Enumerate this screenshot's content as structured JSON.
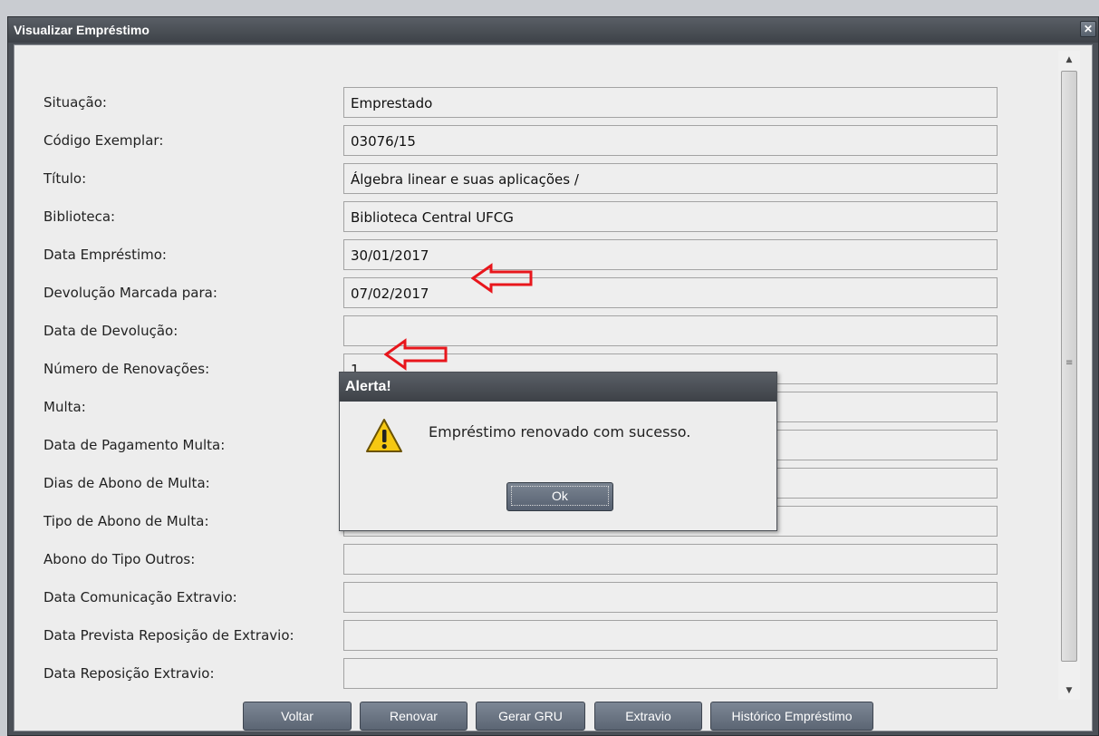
{
  "window": {
    "title": "Visualizar Empréstimo",
    "close_glyph": "✕"
  },
  "form": {
    "rows": [
      {
        "label": "Situação:",
        "value": "Emprestado"
      },
      {
        "label": "Código Exemplar:",
        "value": "03076/15"
      },
      {
        "label": "Título:",
        "value": "Álgebra linear e suas aplicações /"
      },
      {
        "label": "Biblioteca:",
        "value": "Biblioteca Central UFCG"
      },
      {
        "label": "Data Empréstimo:",
        "value": "30/01/2017"
      },
      {
        "label": "Devolução Marcada para:",
        "value": "07/02/2017"
      },
      {
        "label": "Data de Devolução:",
        "value": ""
      },
      {
        "label": "Número de Renovações:",
        "value": "1"
      },
      {
        "label": "Multa:",
        "value": ""
      },
      {
        "label": "Data de Pagamento Multa:",
        "value": ""
      },
      {
        "label": "Dias de Abono de Multa:",
        "value": ""
      },
      {
        "label": "Tipo de Abono de Multa:",
        "value": ""
      },
      {
        "label": "Abono do Tipo Outros:",
        "value": ""
      },
      {
        "label": "Data Comunicação Extravio:",
        "value": ""
      },
      {
        "label": "Data Prevista Reposição de Extravio:",
        "value": ""
      },
      {
        "label": "Data Reposição Extravio:",
        "value": ""
      }
    ]
  },
  "buttons": {
    "voltar": "Voltar",
    "renovar": "Renovar",
    "gerar_gru": "Gerar GRU",
    "extravio": "Extravio",
    "historico": "Histórico Empréstimo"
  },
  "alert": {
    "title": "Alerta!",
    "message": "Empréstimo renovado com sucesso.",
    "ok_label": "Ok",
    "icon": "warning-icon"
  },
  "annotations": {
    "arrow_color": "#e8161c"
  },
  "colors": {
    "titlebar": "#4b5057",
    "panel": "#ededed",
    "button": "#6a7482"
  }
}
